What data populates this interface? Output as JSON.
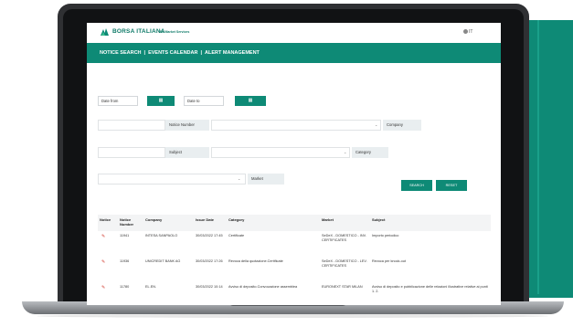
{
  "brand": {
    "name": "BORSA ITALIANA",
    "tagline": "Bit Market Services"
  },
  "lang_label": "IT",
  "nav": {
    "items": [
      "NOTICE SEARCH",
      "EVENTS CALENDAR",
      "ALERT MANAGEMENT"
    ],
    "separator": "|"
  },
  "filters": {
    "date_from": "Date from",
    "date_to": "Date to",
    "calendar_icon": "▦",
    "notice_number": "Notice Number",
    "company": "Company",
    "subject": "Subject",
    "category": "Category",
    "market": "Market",
    "dropdown_icon": "⌄"
  },
  "buttons": {
    "search": "SEARCH",
    "reset": "RESET"
  },
  "table": {
    "headers": [
      "Notice",
      "Notice Number",
      "Company",
      "Issue Date",
      "Category",
      "Market",
      "Subject"
    ],
    "rows": [
      {
        "number": "11941",
        "company": "INTESA SANPAOLO",
        "date": "30/03/2022 17:45",
        "category": "Certificate",
        "market": "SeDeX - DOMESTICO - INV. CERTIFICATES",
        "subject": "Importo periodico"
      },
      {
        "number": "11936",
        "company": "UNICREDIT BANK AG",
        "date": "30/03/2022 17:26",
        "category": "Revoca della quotazione.Certificate",
        "market": "SeDeX - DOMESTICO - LEV. CERTIFICATES",
        "subject": "Revoca per knock-out"
      },
      {
        "number": "11780",
        "company": "EL.EN.",
        "date": "30/03/2022 10:14",
        "category": "Avviso di deposito.Convocazione assemblea",
        "market": "EURONEXT STAR MILAN",
        "subject": "Avviso di deposito e pubblicazione delle relazioni illustrative relative ai punti 1. 2."
      }
    ],
    "pdf_icon": "✎"
  },
  "colors": {
    "brand": "#0e8a76",
    "background_panel": "#0e8a76"
  }
}
